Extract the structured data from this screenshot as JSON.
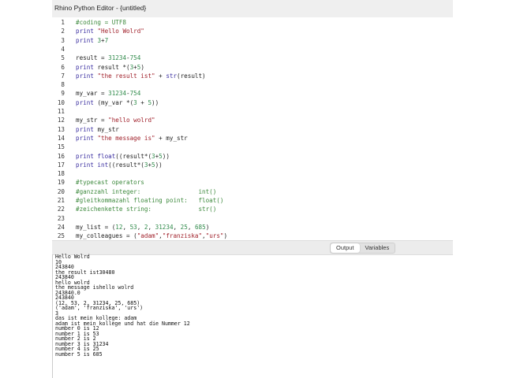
{
  "window": {
    "title": "Rhino Python Editor - {untitled}"
  },
  "editor": {
    "lines": [
      [
        [
          "com",
          "#coding = UTF8"
        ]
      ],
      [
        [
          "kw",
          "print "
        ],
        [
          "str",
          "\"Hello Wolrd\""
        ]
      ],
      [
        [
          "kw",
          "print "
        ],
        [
          "num",
          "3"
        ],
        [
          "plain",
          "+"
        ],
        [
          "num",
          "7"
        ]
      ],
      [],
      [
        [
          "plain",
          "result = "
        ],
        [
          "num",
          "31234"
        ],
        [
          "plain",
          "-"
        ],
        [
          "num",
          "754"
        ]
      ],
      [
        [
          "kw",
          "print "
        ],
        [
          "plain",
          "result *("
        ],
        [
          "num",
          "3"
        ],
        [
          "plain",
          "+"
        ],
        [
          "num",
          "5"
        ],
        [
          "plain",
          ")"
        ]
      ],
      [
        [
          "kw",
          "print "
        ],
        [
          "str",
          "\"the result ist\""
        ],
        [
          "plain",
          " + "
        ],
        [
          "kw",
          "str"
        ],
        [
          "plain",
          "(result)"
        ]
      ],
      [],
      [
        [
          "plain",
          "my_var = "
        ],
        [
          "num",
          "31234"
        ],
        [
          "plain",
          "-"
        ],
        [
          "num",
          "754"
        ]
      ],
      [
        [
          "kw",
          "print "
        ],
        [
          "plain",
          "(my_var *("
        ],
        [
          "num",
          "3"
        ],
        [
          "plain",
          " + "
        ],
        [
          "num",
          "5"
        ],
        [
          "plain",
          "))"
        ]
      ],
      [],
      [
        [
          "plain",
          "my_str = "
        ],
        [
          "str",
          "\"hello wolrd\""
        ]
      ],
      [
        [
          "kw",
          "print "
        ],
        [
          "plain",
          "my_str"
        ]
      ],
      [
        [
          "kw",
          "print "
        ],
        [
          "str",
          "\"the message is\""
        ],
        [
          "plain",
          " + my_str"
        ]
      ],
      [],
      [
        [
          "kw",
          "print float"
        ],
        [
          "plain",
          "((result*("
        ],
        [
          "num",
          "3"
        ],
        [
          "plain",
          "+"
        ],
        [
          "num",
          "5"
        ],
        [
          "plain",
          "))"
        ]
      ],
      [
        [
          "kw",
          "print int"
        ],
        [
          "plain",
          "((result*("
        ],
        [
          "num",
          "3"
        ],
        [
          "plain",
          "+"
        ],
        [
          "num",
          "5"
        ],
        [
          "plain",
          "))"
        ]
      ],
      [],
      [
        [
          "com",
          "#typecast operators"
        ]
      ],
      [
        [
          "com",
          "#ganzzahl integer:                int()"
        ]
      ],
      [
        [
          "com",
          "#gleitkommazahl floating point:   float()"
        ]
      ],
      [
        [
          "com",
          "#zeichenkette string:             str()"
        ]
      ],
      [],
      [
        [
          "plain",
          "my_list = ("
        ],
        [
          "num",
          "12"
        ],
        [
          "plain",
          ", "
        ],
        [
          "num",
          "53"
        ],
        [
          "plain",
          ", "
        ],
        [
          "num",
          "2"
        ],
        [
          "plain",
          ", "
        ],
        [
          "num",
          "31234"
        ],
        [
          "plain",
          ", "
        ],
        [
          "num",
          "25"
        ],
        [
          "plain",
          ", "
        ],
        [
          "num",
          "685"
        ],
        [
          "plain",
          ")"
        ]
      ],
      [
        [
          "plain",
          "my_colleagues = ("
        ],
        [
          "str",
          "\"adam\""
        ],
        [
          "plain",
          ","
        ],
        [
          "str",
          "\"franziska\""
        ],
        [
          "plain",
          ","
        ],
        [
          "str",
          "\"urs\""
        ],
        [
          "plain",
          ")"
        ]
      ]
    ]
  },
  "output_panel": {
    "tabs": [
      {
        "label": "Output",
        "active": true
      },
      {
        "label": "Variables",
        "active": false
      }
    ],
    "lines": [
      "Hello Wolrd",
      "10",
      "243840",
      "the result ist30480",
      "243840",
      "hello wolrd",
      "the message ishello wolrd",
      "243840.0",
      "243840",
      "(12, 53, 2, 31234, 25, 685)",
      "('adam', 'franziska', 'urs')",
      "3",
      "das ist mein kollege: adam",
      "adam ist mein kollege und hat die Nummer 12",
      "number 0 is 12",
      "number 1 is 53",
      "number 2 is 2",
      "number 3 is 31234",
      "number 4 is 25",
      "number 5 is 685"
    ]
  }
}
